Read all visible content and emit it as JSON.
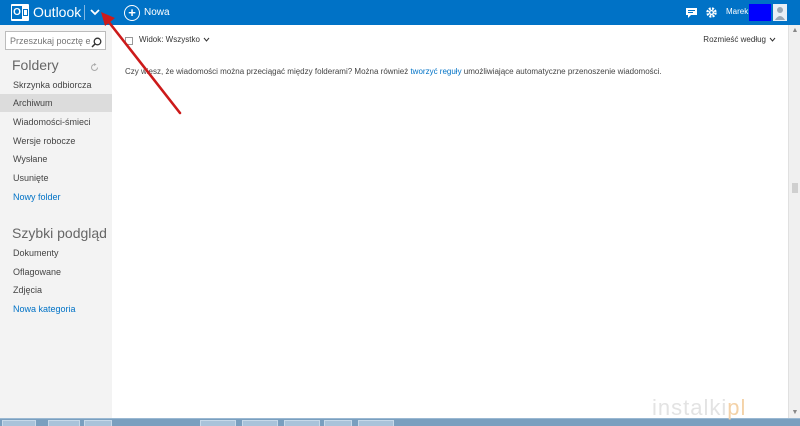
{
  "app": {
    "logo_icon": "outlook-logo-icon",
    "title": "Outlook",
    "menu_icon": "chevron-down-icon",
    "new_label": "Nowa"
  },
  "header": {
    "user_name": "Marek",
    "icons": [
      "chat-icon",
      "gear-icon",
      "avatar-icon"
    ]
  },
  "search": {
    "placeholder": "Przeszukaj pocztę e-"
  },
  "sidebar": {
    "folders_heading": "Foldery",
    "folders": [
      {
        "label": "Skrzynka odbiorcza"
      },
      {
        "label": "Archiwum"
      },
      {
        "label": "Wiadomości-śmieci"
      },
      {
        "label": "Wersje robocze"
      },
      {
        "label": "Wysłane"
      },
      {
        "label": "Usunięte"
      }
    ],
    "selected_folder": "Archiwum",
    "new_folder_label": "Nowy folder",
    "quick_view_heading": "Szybki podgląd",
    "quick_view": [
      {
        "label": "Dokumenty"
      },
      {
        "label": "Oflagowane"
      },
      {
        "label": "Zdjęcia"
      }
    ],
    "new_category_label": "Nowa kategoria"
  },
  "list": {
    "view_label": "Widok: Wszystko",
    "sort_label": "Rozmieść według",
    "tip_before": "Czy wiesz, że wiadomości można przeciągać między folderami? Można również ",
    "tip_link": "tworzyć reguły",
    "tip_after": " umożliwiające automatyczne przenoszenie wiadomości."
  },
  "watermark": {
    "text": "instalki",
    "suffix": "pl"
  },
  "colors": {
    "brand": "#0072c6",
    "selected": "#dcdcdc",
    "annotation_arrow": "#cc1a1a"
  }
}
